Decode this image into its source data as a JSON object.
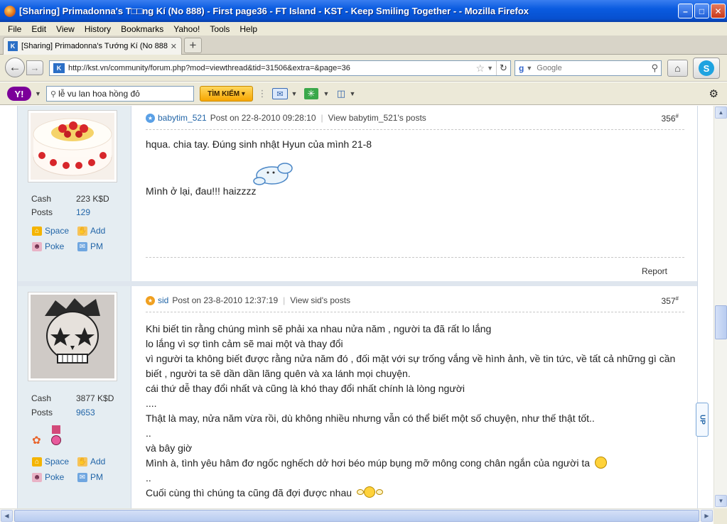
{
  "window": {
    "title": "[Sharing] Primadonna's T□□ng Kí (No 888) - First page36 - FT Island - KST - Keep Smiling Together - - Mozilla Firefox",
    "min_glyph": "–",
    "max_glyph": "□",
    "close_glyph": "✕"
  },
  "menu": [
    "File",
    "Edit",
    "View",
    "History",
    "Bookmarks",
    "Yahoo!",
    "Tools",
    "Help"
  ],
  "tab": {
    "label": "[Sharing] Primadonna's Tướng Kí (No 888) - ...",
    "close_glyph": "✕",
    "new_tab_glyph": "+"
  },
  "nav": {
    "url": "http://kst.vn/community/forum.php?mod=viewthread&tid=31506&extra=&page=36",
    "search_placeholder": "Google"
  },
  "yahoo": {
    "logo": "Y!",
    "search_value": "lễ vu lan hoa hồng đỏ",
    "search_button": "TÌM KIẾM ▾"
  },
  "posts": [
    {
      "author": "babytim_521",
      "posted": "Post on 22-8-2010 09:28:10",
      "view_link": "View babytim_521's posts",
      "number": "356",
      "cash_label": "Cash",
      "cash_value": "223 K$D",
      "posts_label": "Posts",
      "posts_value": "129",
      "actions": [
        "Space",
        "Add",
        "Poke",
        "PM"
      ],
      "lines": [
        "hqua. chia tay. Đúng sinh nhật Hyun của mình  21-8",
        "Mình ở lại, đau!!! haizzzz"
      ],
      "report": "Report"
    },
    {
      "author": "sid",
      "posted": "Post on 23-8-2010 12:37:19",
      "view_link": "View sid's posts",
      "number": "357",
      "cash_label": "Cash",
      "cash_value": "3877 K$D",
      "posts_label": "Posts",
      "posts_value": "9653",
      "actions": [
        "Space",
        "Add",
        "Poke",
        "PM"
      ],
      "lines": [
        "Khi biết tin rằng chúng mình sẽ phải xa nhau nửa năm , người ta đã rất lo lắng",
        "lo lắng vì sợ tình cảm sẽ mai một và thay đổi",
        "vì người ta không biết được rằng nửa năm đó , đối mặt với sự trống vắng về hình ảnh, về tin tức, về tất cả những gì cần",
        "biết , người ta sẽ dần dần lãng quên và xa lánh mọi chuyện.",
        "cái thứ dễ thay đổi nhất và cũng là khó thay đổi nhất chính là lòng người",
        "....",
        "Thật là may, nửa năm vừa rồi, dù không nhiều nhưng vẫn có thể biết một số chuyện, như thế thật tốt..",
        "..",
        "và bây giờ",
        "Mình à, tình yêu hâm đơ ngốc nghếch dở hơi béo múp bụng mỡ mông cong chân ngắn của người ta",
        "..",
        "Cuối cùng thì chúng ta cũng đã đợi được nhau"
      ]
    }
  ],
  "up_button": "UP",
  "icons": {
    "back": "back-arrow-icon",
    "forward": "forward-arrow-icon",
    "star": "bookmark-star-icon",
    "reload": "reload-icon",
    "home": "home-icon",
    "skype": "skype-icon",
    "gear": "gear-icon"
  },
  "colors": {
    "titlebar": "#0a5be0",
    "link": "#2366a8",
    "sidebar_bg": "#e5edf2",
    "search_button": "#f7a600",
    "yahoo_purple": "#7b0099"
  }
}
